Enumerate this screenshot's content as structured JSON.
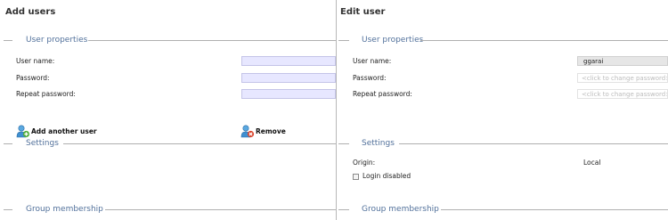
{
  "add_users": {
    "title": "Add users",
    "section_user_properties": "User properties",
    "labels": {
      "user_name": "User name:",
      "password": "Password:",
      "repeat_password": "Repeat password:"
    },
    "fields": {
      "user_name": "",
      "password": "",
      "repeat_password": ""
    },
    "add_another_user": "Add another user",
    "remove": "Remove",
    "section_settings": "Settings",
    "section_group_membership": "Group membership"
  },
  "edit_user": {
    "title": "Edit user",
    "section_user_properties": "User properties",
    "labels": {
      "user_name": "User name:",
      "password": "Password:",
      "repeat_password": "Repeat password:"
    },
    "fields": {
      "user_name": "ggarai",
      "password_placeholder": "<click to change password>",
      "repeat_password_placeholder": "<click to change password>"
    },
    "section_settings": "Settings",
    "origin_label": "Origin:",
    "origin_value": "Local",
    "login_disabled_label": "Login disabled",
    "login_disabled_checked": false,
    "section_group_membership": "Group membership"
  },
  "colors": {
    "section_title": "#52719b",
    "input_bg": "#e7e7ff",
    "readonly_bg": "#e6e6e6",
    "divider": "#b8b8b8"
  },
  "icons": {
    "add_user": "user-add-icon",
    "remove_user": "user-remove-icon"
  }
}
